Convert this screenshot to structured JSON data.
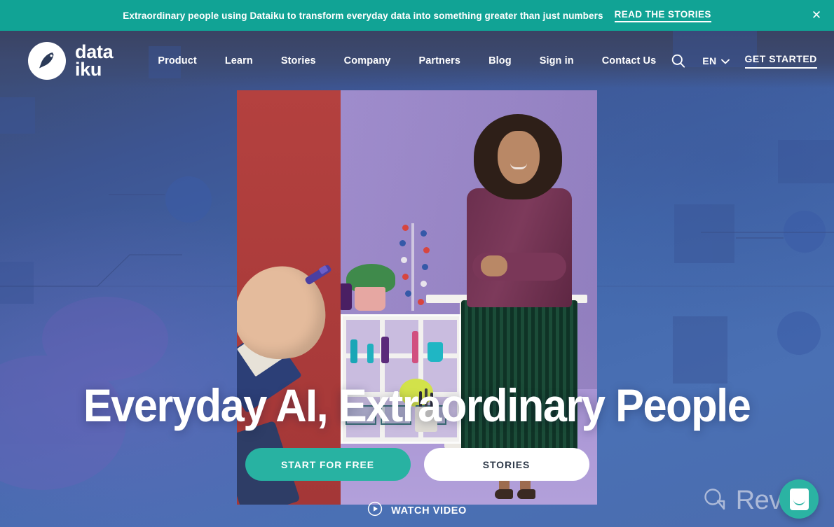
{
  "banner": {
    "message": "Extraordinary people using Dataiku to transform everyday data into something greater than just numbers",
    "link_label": "READ THE STORIES",
    "close_icon": "close-icon",
    "background_color": "#11a395"
  },
  "nav": {
    "logo_text": "data\niku",
    "logo_line1": "data",
    "logo_line2": "iku",
    "links": [
      {
        "label": "Product"
      },
      {
        "label": "Learn"
      },
      {
        "label": "Stories"
      },
      {
        "label": "Company"
      },
      {
        "label": "Partners"
      },
      {
        "label": "Blog"
      },
      {
        "label": "Sign in"
      },
      {
        "label": "Contact Us"
      }
    ],
    "search_icon": "search-icon",
    "language": "EN",
    "language_chevron": "chevron-down-icon",
    "cta_label": "GET STARTED",
    "background_color": "#3b4668"
  },
  "hero": {
    "headline": "Everyday AI, Extraordinary People",
    "primary_button": "START FOR FREE",
    "secondary_button": "STORIES",
    "watch_label": "WATCH VIDEO",
    "watch_icon": "play-circle-icon",
    "primary_color": "#28b2a2",
    "background_gradient": "#3d5592 to #4b6cae"
  },
  "watermark": {
    "label": "Revain",
    "icon": "revain-logo-icon"
  },
  "chat": {
    "icon": "chat-bubble-icon",
    "color": "#2bb3a3"
  }
}
